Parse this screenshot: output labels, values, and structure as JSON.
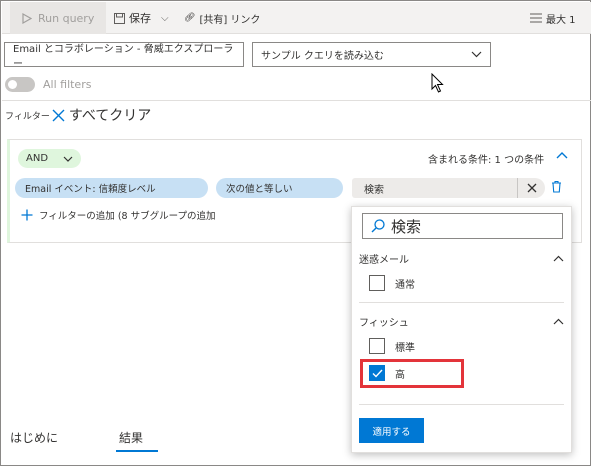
{
  "toolbar": {
    "run_query": "Run query",
    "save": "保存",
    "share_link": "[共有] リンク",
    "max": "最大 1"
  },
  "selectors": {
    "source": "Email とコラボレーション - 脅威エクスプローラー",
    "sample_query": "サンプル クエリを読み込む"
  },
  "all_filters": "All filters",
  "filters": {
    "label": "フィルター",
    "clear_all": "すべてクリア"
  },
  "panel": {
    "operator": "AND",
    "condition_count": "含まれる条件: 1 つの条件",
    "field": "Email イベント: 信頼度レベル",
    "comparison": "次の値と等しい",
    "value_search": "検索",
    "add_filter": "フィルターの追加 (8   サブグループの追加"
  },
  "dropdown": {
    "search_placeholder": "検索",
    "groups": [
      {
        "label": "迷惑メール",
        "options": [
          {
            "label": "通常",
            "checked": false
          }
        ]
      },
      {
        "label": "フィッシュ",
        "options": [
          {
            "label": "標準",
            "checked": false
          },
          {
            "label": "高",
            "checked": true
          }
        ]
      }
    ],
    "apply": "適用する"
  },
  "tabs": [
    {
      "label": "はじめに"
    },
    {
      "label": "結果",
      "active": true
    }
  ],
  "colors": {
    "accent": "#0078d4",
    "pill_blue": "#c7e0f4",
    "and_green": "#dff6dd",
    "highlight_red": "#e3343a"
  }
}
